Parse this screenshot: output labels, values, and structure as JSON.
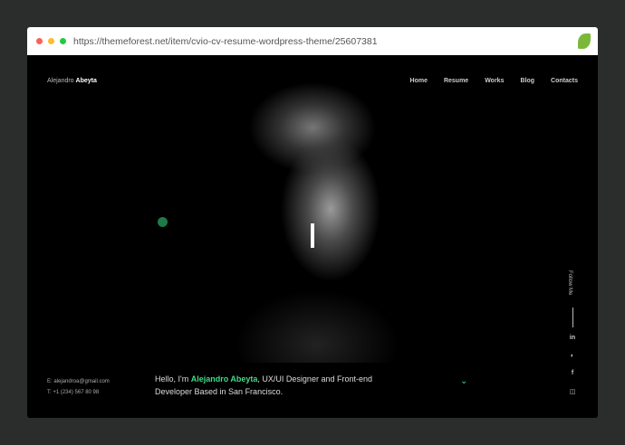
{
  "browser": {
    "url": "https://themeforest.net/item/cvio-cv-resume-wordpress-theme/25607381",
    "colors": {
      "close": "#ff5f57",
      "min": "#febc2e",
      "max": "#28c840"
    }
  },
  "site": {
    "logo_first": "Alejandro",
    "logo_last": "Abeyta",
    "nav": [
      {
        "label": "Home"
      },
      {
        "label": "Resume"
      },
      {
        "label": "Works"
      },
      {
        "label": "Blog"
      },
      {
        "label": "Contacts"
      }
    ],
    "email": "E: alejandroa@gmail.com",
    "phone": "T: +1 (234) 567 80 98",
    "intro_pre": "Hello, I'm ",
    "intro_name": "Alejandro Abeyta",
    "intro_post": ", UX/UI Designer and Front-end Developer Based in San Francisco.",
    "follow": "Follow Me",
    "accent": "#3ddc84",
    "social": [
      {
        "icon": "linkedin-icon",
        "glyph": "in"
      },
      {
        "icon": "github-icon",
        "glyph": "◐"
      },
      {
        "icon": "facebook-icon",
        "glyph": "f"
      },
      {
        "icon": "instagram-icon",
        "glyph": "◫"
      }
    ]
  }
}
